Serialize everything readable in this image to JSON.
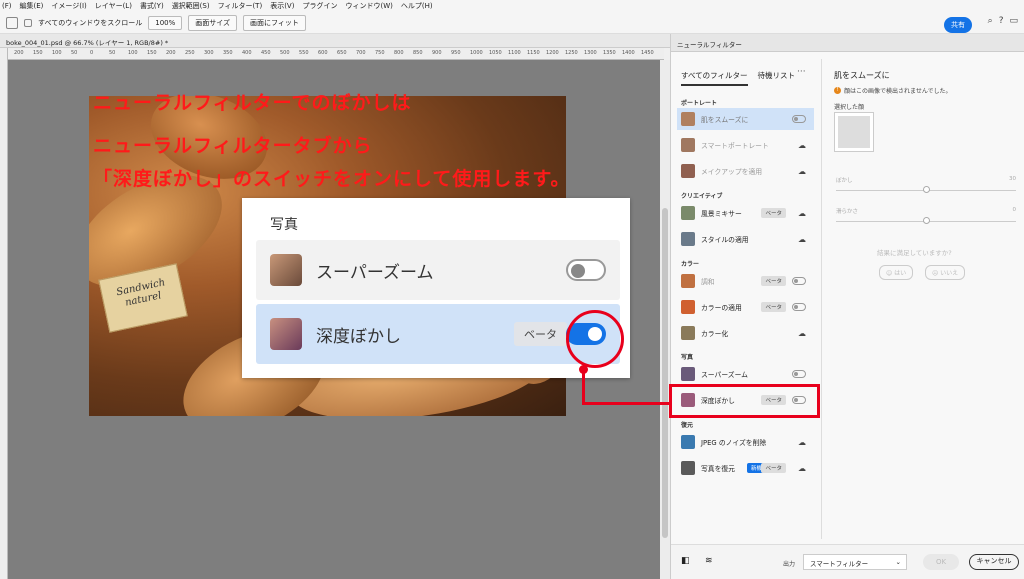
{
  "menu": [
    "(F)",
    "編集(E)",
    "イメージ(I)",
    "レイヤー(L)",
    "書式(Y)",
    "選択範囲(S)",
    "フィルター(T)",
    "表示(V)",
    "プラグイン",
    "ウィンドウ(W)",
    "ヘルプ(H)"
  ],
  "options": {
    "scroll_all_label": "すべてのウィンドウをスクロール",
    "zoom_100": "100%",
    "fit_screen": "画面サイズ",
    "fill_screen": "画面にフィット",
    "share": "共有"
  },
  "document": {
    "tab_title": "boke_004_01.psd @ 66.7% (レイヤー 1, RGB/8#) *",
    "ruler_ticks": [
      "200",
      "150",
      "100",
      "50",
      "0",
      "50",
      "100",
      "150",
      "200",
      "250",
      "300",
      "350",
      "400",
      "450",
      "500",
      "550",
      "600",
      "650",
      "700",
      "750",
      "800",
      "850",
      "900",
      "950",
      "1000",
      "1050",
      "1100",
      "1150",
      "1200",
      "1250",
      "1300",
      "1350",
      "1400",
      "1450"
    ]
  },
  "annotation": {
    "line1": "ニューラルフィルターでのぼかしは",
    "line2": "ニューラルフィルタータブから",
    "line3": "「深度ぼかし」のスイッチをオンにして使用します。"
  },
  "photo_sign": {
    "text1": "Sandwich",
    "text2": "naturel"
  },
  "popup": {
    "heading": "写真",
    "rows": [
      {
        "label": "スーパーズーム",
        "toggle_on": false
      },
      {
        "label": "深度ぼかし",
        "badge": "ベータ",
        "toggle_on": true
      }
    ]
  },
  "panel": {
    "title": "ニューラルフィルター",
    "tabs": [
      "すべてのフィルター",
      "待機リスト"
    ],
    "more": "···",
    "categories": [
      {
        "name": "ポートレート",
        "items": [
          {
            "label": "肌をスムーズに",
            "control": "toggle",
            "selected": true
          },
          {
            "label": "スマートポートレート",
            "control": "cloud"
          },
          {
            "label": "メイクアップを適用",
            "control": "cloud"
          }
        ]
      },
      {
        "name": "クリエイティブ",
        "items": [
          {
            "label": "風景ミキサー",
            "badge": "ベータ",
            "control": "cloud"
          },
          {
            "label": "スタイルの適用",
            "control": "cloud"
          }
        ]
      },
      {
        "name": "カラー",
        "items": [
          {
            "label": "調和",
            "badge": "ベータ",
            "control": "toggle"
          },
          {
            "label": "カラーの適用",
            "badge": "ベータ",
            "control": "toggle"
          },
          {
            "label": "カラー化",
            "control": "cloud"
          }
        ]
      },
      {
        "name": "写真",
        "items": [
          {
            "label": "スーパーズーム",
            "control": "toggle"
          },
          {
            "label": "深度ぼかし",
            "badge": "ベータ",
            "control": "toggle"
          }
        ]
      },
      {
        "name": "復元",
        "items": [
          {
            "label": "JPEG のノイズを削除",
            "control": "cloud"
          },
          {
            "label": "写真を復元",
            "badge_new": "新機",
            "badge": "ベータ",
            "control": "cloud"
          }
        ]
      }
    ],
    "detail": {
      "title": "肌をスムーズに",
      "warning": "顔はこの画像で検出されませんでした。",
      "selected_face": "選択した顔",
      "slider1": {
        "label": "ぼかし",
        "value": "30"
      },
      "slider2": {
        "label": "滑らかさ",
        "value": "0"
      },
      "feedback_q": "結果に満足していますか?",
      "yes": "はい",
      "no": "いいえ"
    },
    "output_label": "出力",
    "output_value": "スマートフィルター",
    "ok": "OK",
    "cancel": "キャンセル"
  }
}
